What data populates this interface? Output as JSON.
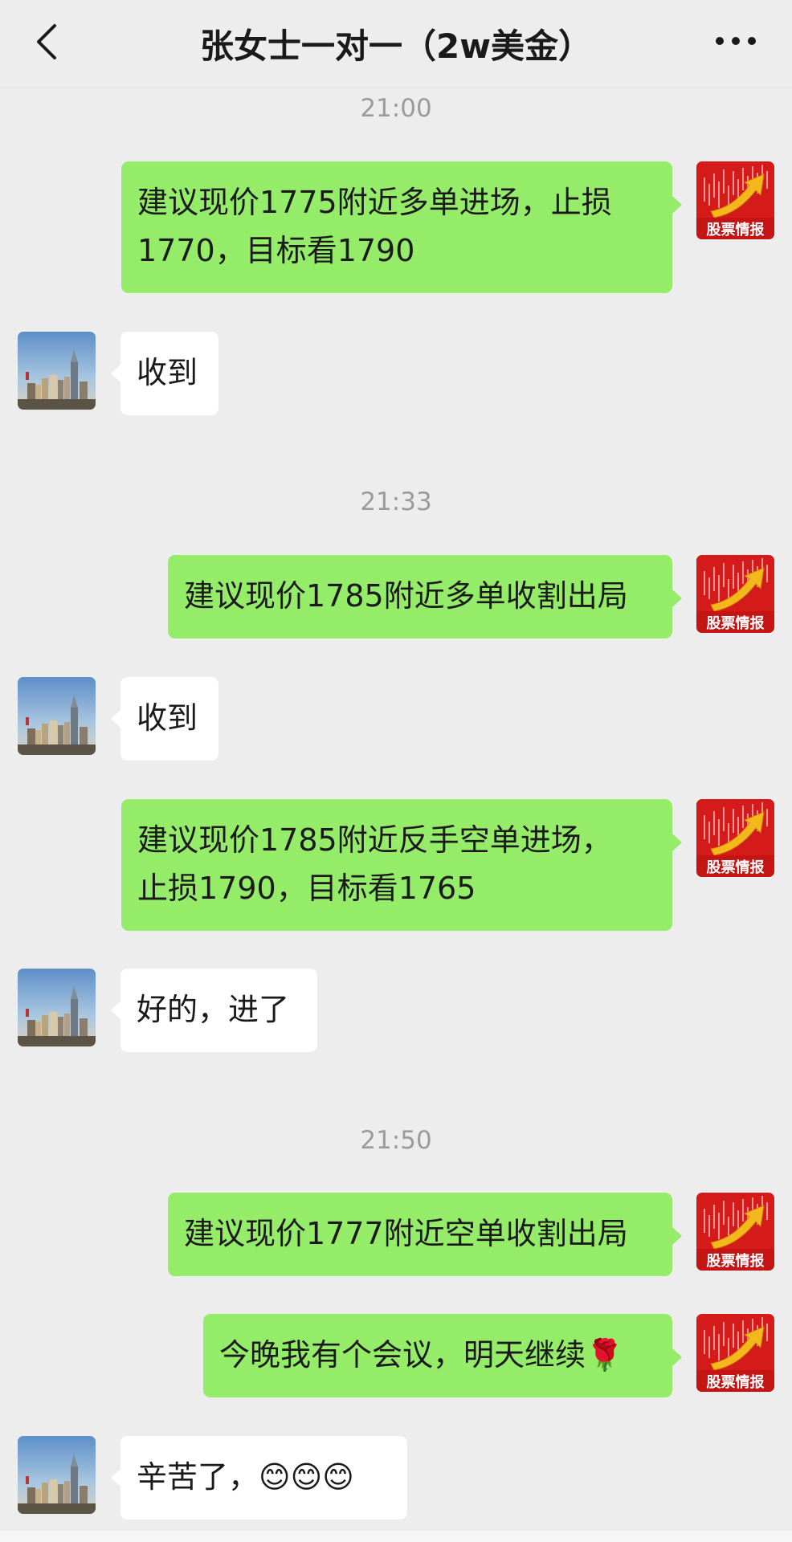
{
  "header": {
    "title": "张女士一对一（2w美金）"
  },
  "icons": {
    "back": "chevron-left-icon",
    "more": "more-dots-icon",
    "outgoing_avatar": "stock-news-avatar",
    "incoming_avatar": "city-skyline-avatar"
  },
  "colors": {
    "background": "#ededed",
    "outgoing_bubble": "#95ec69",
    "incoming_bubble": "#ffffff",
    "timestamp": "#9b9b9b",
    "avatar_red": "#d51a1a"
  },
  "avatar_label": "股票情报",
  "messages": {
    "t1": "21:00",
    "m1_line1": "建议现价1775附近多单进场，止损",
    "m1_line2": "1770，目标看1790",
    "m2": "收到",
    "t2": "21:33",
    "m3": "建议现价1785附近多单收割出局",
    "m4": "收到",
    "m5_line1": "建议现价1785附近反手空单进场，",
    "m5_line2": "止损1790，目标看1765",
    "m6": "好的，进了",
    "t3": "21:50",
    "m7": "建议现价1777附近空单收割出局",
    "m8_text": "今晚我有个会议，明天继续",
    "m8_emoji": "🌹",
    "m9_text": "辛苦了，",
    "m9_emoji": "😊😊😊"
  }
}
